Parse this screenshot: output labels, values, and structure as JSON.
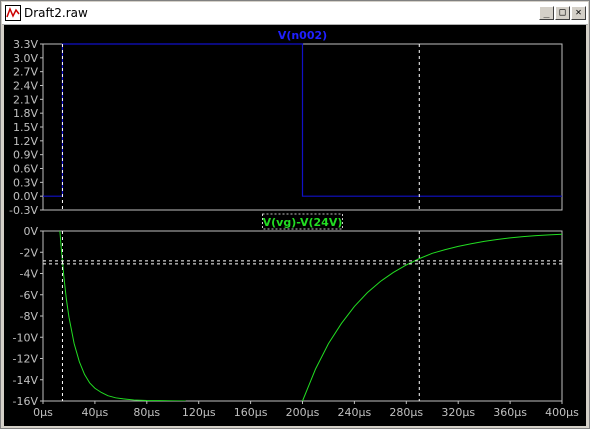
{
  "window": {
    "title": "Draft2.raw",
    "buttons": {
      "minimize": "_",
      "maximize": "□",
      "close": "✕"
    },
    "icon": "waveform-icon"
  },
  "colors": {
    "background": "#000000",
    "grid_frame": "#c0c0c0",
    "axis_text": "#c0c0c0",
    "trace_top": "#1010c8",
    "label_top": "#2020ff",
    "trace_bottom": "#22dd22",
    "cursor": "#ffffff"
  },
  "chart_data": [
    {
      "type": "line",
      "title": "V(n002)",
      "xlabel": "",
      "ylabel": "",
      "xlim": [
        0,
        400
      ],
      "x_unit": "µs",
      "ylim": [
        -0.3,
        3.3
      ],
      "y_ticks": [
        "3.3V",
        "3.0V",
        "2.7V",
        "2.4V",
        "2.1V",
        "1.8V",
        "1.5V",
        "1.2V",
        "0.9V",
        "0.6V",
        "0.3V",
        "0.0V",
        "-0.3V"
      ],
      "y_tick_values": [
        3.3,
        3.0,
        2.7,
        2.4,
        2.1,
        1.8,
        1.5,
        1.2,
        0.9,
        0.6,
        0.3,
        0.0,
        -0.3
      ],
      "series": [
        {
          "name": "V(n002)",
          "x": [
            0,
            15,
            15,
            200,
            200,
            400
          ],
          "y": [
            0,
            0,
            3.3,
            3.3,
            0,
            0
          ]
        }
      ],
      "grid": false
    },
    {
      "type": "line",
      "title": "V(vg)-V(24V)",
      "xlabel": "",
      "ylabel": "",
      "xlim": [
        0,
        400
      ],
      "x_unit": "µs",
      "ylim": [
        -16,
        0
      ],
      "y_ticks": [
        "0V",
        "-2V",
        "-4V",
        "-6V",
        "-8V",
        "-10V",
        "-12V",
        "-14V",
        "-16V"
      ],
      "y_tick_values": [
        0,
        -2,
        -4,
        -6,
        -8,
        -10,
        -12,
        -14,
        -16
      ],
      "x_ticks": [
        "0µs",
        "40µs",
        "80µs",
        "120µs",
        "160µs",
        "200µs",
        "240µs",
        "280µs",
        "320µs",
        "360µs",
        "400µs"
      ],
      "x_tick_values": [
        0,
        40,
        80,
        120,
        160,
        200,
        240,
        280,
        320,
        360,
        400
      ],
      "series": [
        {
          "name": "V(vg)-V(24V)",
          "x": [
            13,
            14,
            16,
            18,
            20,
            24,
            28,
            32,
            36,
            40,
            45,
            50,
            56,
            62,
            70,
            80,
            90,
            100,
            110
          ],
          "y": [
            0,
            -1.5,
            -4.2,
            -6.4,
            -8.1,
            -10.6,
            -12.3,
            -13.5,
            -14.3,
            -14.8,
            -15.2,
            -15.5,
            -15.7,
            -15.8,
            -15.9,
            -15.95,
            -15.97,
            -15.99,
            -16.0
          ],
          "x2": [
            200,
            202,
            205,
            210,
            220,
            230,
            240,
            250,
            260,
            270,
            280,
            290,
            300,
            310,
            320,
            330,
            340,
            350,
            360,
            370,
            380,
            390,
            400
          ],
          "y2": [
            -16.0,
            -15.4,
            -14.5,
            -13.0,
            -10.6,
            -8.7,
            -7.1,
            -5.8,
            -4.75,
            -3.9,
            -3.2,
            -2.6,
            -2.1,
            -1.75,
            -1.45,
            -1.2,
            -0.98,
            -0.8,
            -0.65,
            -0.53,
            -0.44,
            -0.36,
            -0.3
          ]
        }
      ],
      "grid": false
    }
  ],
  "cursors": {
    "x_values": [
      15,
      290
    ],
    "y_value_bottom": -3.0
  }
}
